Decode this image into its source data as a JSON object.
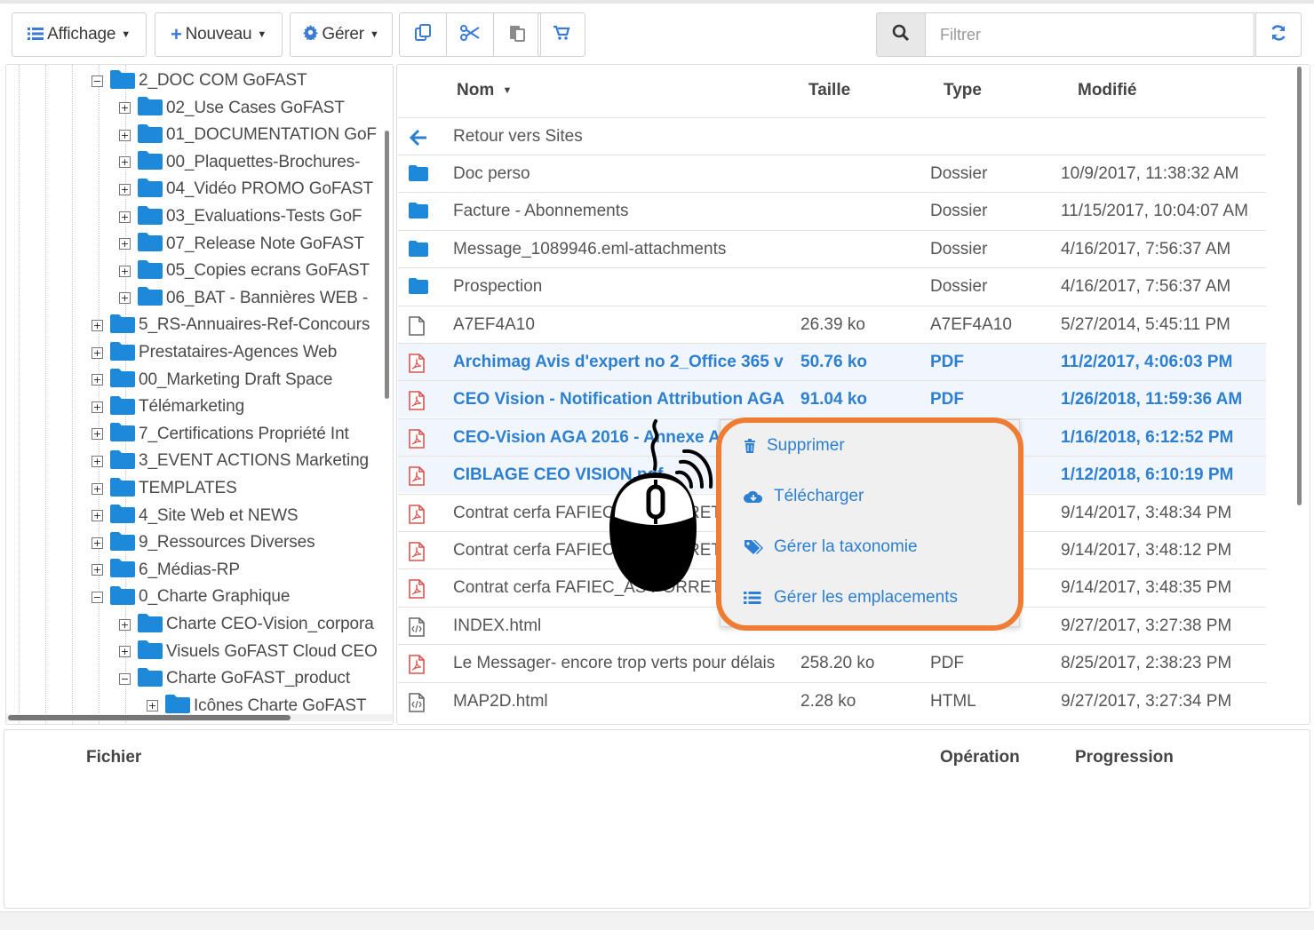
{
  "toolbar": {
    "view_label": "Affichage",
    "new_label": "Nouveau",
    "manage_label": "Gérer",
    "filter_placeholder": "Filtrer"
  },
  "tree": {
    "items": [
      {
        "label": "2_DOC COM GoFAST",
        "toggle": "−"
      },
      {
        "label": "02_Use Cases GoFAST",
        "toggle": "+"
      },
      {
        "label": "01_DOCUMENTATION GoF",
        "toggle": "+"
      },
      {
        "label": "00_Plaquettes-Brochures-",
        "toggle": "+"
      },
      {
        "label": "04_Vidéo PROMO GoFAST",
        "toggle": "+"
      },
      {
        "label": "03_Evaluations-Tests GoF",
        "toggle": "+"
      },
      {
        "label": "07_Release Note GoFAST",
        "toggle": "+"
      },
      {
        "label": "05_Copies ecrans GoFAST",
        "toggle": "+"
      },
      {
        "label": "06_BAT - Bannières WEB -",
        "toggle": "+"
      },
      {
        "label": "5_RS-Annuaires-Ref-Concours",
        "toggle": "+"
      },
      {
        "label": "Prestataires-Agences Web",
        "toggle": "+"
      },
      {
        "label": "00_Marketing Draft Space",
        "toggle": "+"
      },
      {
        "label": "Télémarketing",
        "toggle": "+"
      },
      {
        "label": "7_Certifications Propriété Int",
        "toggle": "+"
      },
      {
        "label": "3_EVENT ACTIONS Marketing",
        "toggle": "+"
      },
      {
        "label": "TEMPLATES",
        "toggle": "+"
      },
      {
        "label": "4_Site Web et NEWS",
        "toggle": "+"
      },
      {
        "label": "9_Ressources Diverses",
        "toggle": "+"
      },
      {
        "label": "6_Médias-RP",
        "toggle": "+"
      },
      {
        "label": "0_Charte Graphique",
        "toggle": "−"
      },
      {
        "label": "Charte CEO-Vision_corpora",
        "toggle": "+"
      },
      {
        "label": "Visuels GoFAST Cloud CEO",
        "toggle": "+"
      },
      {
        "label": "Charte GoFAST_product",
        "toggle": "−"
      },
      {
        "label": "Icônes Charte GoFAST",
        "toggle": "+"
      }
    ]
  },
  "files": {
    "headers": {
      "name": "Nom",
      "size": "Taille",
      "type": "Type",
      "modified": "Modifié"
    },
    "back_label": "Retour vers Sites",
    "rows": [
      {
        "name": "Doc perso",
        "size": "",
        "type": "Dossier",
        "modified": "10/9/2017, 11:38:32 AM",
        "icon": "folder-icon"
      },
      {
        "name": "Facture - Abonnements",
        "size": "",
        "type": "Dossier",
        "modified": "11/15/2017, 10:04:07 AM",
        "icon": "folder-icon"
      },
      {
        "name": "Message_1089946.eml-attachments",
        "size": "",
        "type": "Dossier",
        "modified": "4/16/2017, 7:56:37 AM",
        "icon": "folder-icon"
      },
      {
        "name": "Prospection",
        "size": "",
        "type": "Dossier",
        "modified": "4/16/2017, 7:56:37 AM",
        "icon": "folder-icon"
      },
      {
        "name": "A7EF4A10",
        "size": "26.39 ko",
        "type": "A7EF4A10",
        "modified": "5/27/2014, 5:45:11 PM",
        "icon": "file-icon"
      },
      {
        "name": "Archimag Avis d'expert no 2_Office 365 v",
        "size": "50.76 ko",
        "type": "PDF",
        "modified": "11/2/2017, 4:06:03 PM",
        "icon": "pdf-icon",
        "selected": true
      },
      {
        "name": "CEO Vision - Notification Attribution AGA",
        "size": "91.04 ko",
        "type": "PDF",
        "modified": "1/26/2018, 11:59:36 AM",
        "icon": "pdf-icon",
        "selected": true
      },
      {
        "name": "CEO-Vision AGA 2016 - Annexe A",
        "size": "",
        "type": "",
        "modified": "1/16/2018, 6:12:52 PM",
        "icon": "pdf-icon",
        "selected": true
      },
      {
        "name": "CIBLAGE CEO VISION.pdf",
        "size": "",
        "type": "",
        "modified": "1/12/2018, 6:10:19 PM",
        "icon": "pdf-icon",
        "selected": true
      },
      {
        "name": "Contrat cerfa FAFIEC_AS PORRET",
        "size": "",
        "type": "",
        "modified": "9/14/2017, 3:48:34 PM",
        "icon": "pdf-icon"
      },
      {
        "name": "Contrat cerfa FAFIEC_AS PORRET",
        "size": "",
        "type": "",
        "modified": "9/14/2017, 3:48:12 PM",
        "icon": "pdf-icon"
      },
      {
        "name": "Contrat cerfa FAFIEC_AS PORRET",
        "size": "",
        "type": "",
        "modified": "9/14/2017, 3:48:35 PM",
        "icon": "pdf-icon"
      },
      {
        "name": "INDEX.html",
        "size": "",
        "type": "",
        "modified": "9/27/2017, 3:27:38 PM",
        "icon": "html-icon"
      },
      {
        "name": "Le Messager- encore trop verts pour délais",
        "size": "258.20 ko",
        "type": "PDF",
        "modified": "8/25/2017, 2:38:23 PM",
        "icon": "pdf-icon"
      },
      {
        "name": "MAP2D.html",
        "size": "2.28 ko",
        "type": "HTML",
        "modified": "9/27/2017, 3:27:34 PM",
        "icon": "html-icon"
      }
    ]
  },
  "context_menu": {
    "items": [
      {
        "label": "Supprimer",
        "icon": "trash-icon"
      },
      {
        "label": "Télécharger",
        "icon": "cloud-download-icon"
      },
      {
        "label": "Gérer la taxonomie",
        "icon": "tags-icon"
      },
      {
        "label": "Gérer les emplacements",
        "icon": "list-icon"
      }
    ],
    "highlight_color": "#ee7d33"
  },
  "uploads": {
    "headers": {
      "file": "Fichier",
      "operation": "Opération",
      "progress": "Progression"
    }
  },
  "colors": {
    "accent": "#2d7fd1",
    "folder": "#1e88d9",
    "pdf": "#d9534f",
    "selected_bg": "#f1f6fd"
  }
}
